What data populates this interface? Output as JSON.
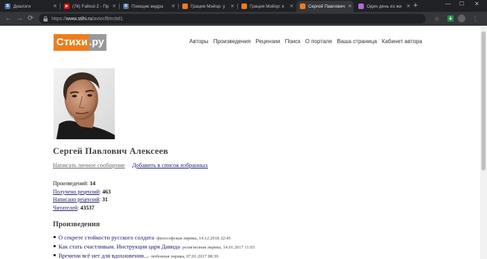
{
  "browser": {
    "tabs": [
      {
        "title": "Диалоги",
        "favicon": "vk-icon",
        "color": "#4a76a8",
        "glyph": "B"
      },
      {
        "title": "(76) Fallout 2 - Пр",
        "favicon": "youtube-icon",
        "color": "#ff0000",
        "glyph": "▶"
      },
      {
        "title": "Поющие ведра",
        "favicon": "vk-icon",
        "color": "#4a76a8",
        "glyph": "B"
      },
      {
        "title": "Грация Мэйор: у",
        "favicon": "stihi-icon",
        "color": "#ef7c1d",
        "glyph": ""
      },
      {
        "title": "Грация Мэйор: к",
        "favicon": "stihi-icon",
        "color": "#ef7c1d",
        "glyph": ""
      },
      {
        "title": "Сергей Павлович",
        "favicon": "stihi-icon",
        "color": "#ef7c1d",
        "glyph": ""
      },
      {
        "title": "Один день из жи",
        "favicon": "page-icon",
        "color": "#b06ad6",
        "glyph": ""
      }
    ],
    "active_tab": 5,
    "url_scheme": "https://",
    "url_host": "www.stihi.ru",
    "url_path": "/avtor/fktrcttd1"
  },
  "site": {
    "logo_main": "Стихи",
    "logo_suffix": ".ру",
    "nav": [
      "Авторы",
      "Произведения",
      "Рецензии",
      "Поиск",
      "О портале",
      "Ваша страница",
      "Кабинет автора"
    ]
  },
  "author": {
    "name": "Сергей Павлович Алексеев",
    "send_message": "Написать личное сообщение",
    "add_favorite": "Добавить в список избранных",
    "stats": {
      "works_label": "Произведений",
      "works_value": "14",
      "received_label": "Получено рецензий",
      "received_value": "463",
      "written_label": "Написано рецензий",
      "written_value": "31",
      "readers_label": "Читателей",
      "readers_value": "43537"
    }
  },
  "works_section": {
    "title": "Произведения",
    "items": [
      {
        "title": "О секрете стойкости русского солдата",
        "meta": " - философская лирика, 14.12.2018 22:45"
      },
      {
        "title": "Как стать счастливым. Инструкция царя Давида",
        "meta": " - религиозная лирика, 14.01.2017 11:03"
      },
      {
        "title": "Времени всё нет для вдохновения...",
        "meta": " - любовная лирика, 07.01.2017 08:39"
      }
    ]
  }
}
